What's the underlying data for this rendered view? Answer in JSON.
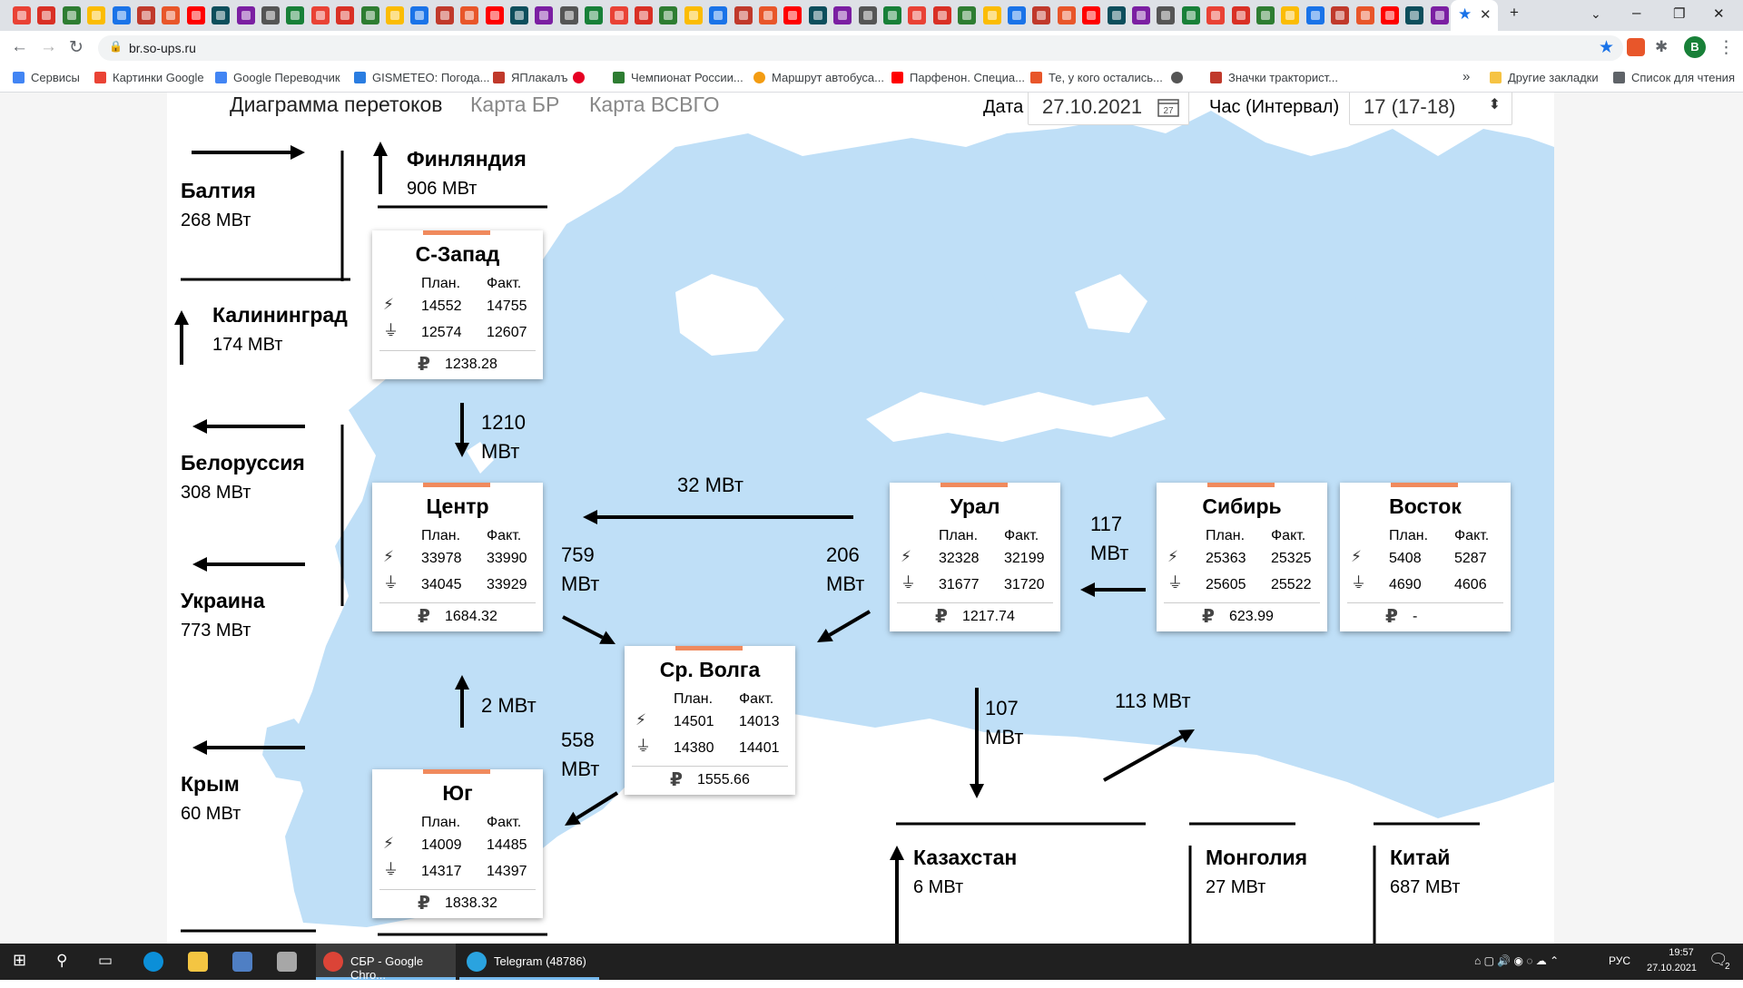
{
  "browser": {
    "url": "br.so-ups.ru",
    "profile_initial": "В",
    "bookmarks": [
      "Сервисы",
      "Картинки Google",
      "Google Переводчик",
      "GISMETEO: Погода...",
      "ЯПлакалъ",
      "Чемпионат России...",
      "Маршрут автобуса...",
      "Парфенон. Специа...",
      "Те, у кого остались...",
      "Значки тракторист..."
    ],
    "bookmarks_right": [
      "Другие закладки",
      "Список для чтения"
    ],
    "bookmarks_more": "»"
  },
  "header": {
    "tabs": [
      "Диаграмма перетоков",
      "Карта БР",
      "Карта ВСВГО"
    ],
    "date_label": "Дата",
    "date_value": "27.10.2021",
    "calendar_day": "27",
    "hour_label": "Час (Интервал)",
    "hour_value": "17 (17-18)"
  },
  "countries": [
    {
      "name": "Балтия",
      "value": "268 МВт"
    },
    {
      "name": "Финляндия",
      "value": "906 МВт"
    },
    {
      "name": "Калининград",
      "value": "174 МВт"
    },
    {
      "name": "Белоруссия",
      "value": "308 МВт"
    },
    {
      "name": "Украина",
      "value": "773 МВт"
    },
    {
      "name": "Крым",
      "value": "60 МВт"
    },
    {
      "name": "Казахстан",
      "value": "6 МВт"
    },
    {
      "name": "Монголия",
      "value": "27 МВт"
    },
    {
      "name": "Китай",
      "value": "687 МВт"
    }
  ],
  "table_headers": {
    "plan": "План.",
    "fact": "Факт.",
    "ruble": "₽"
  },
  "icons": {
    "generation": "lightning-icon",
    "consumption": "plug-icon"
  },
  "colors": {
    "accent": "#f08a5d",
    "map_land": "#bfdff7",
    "map_bg": "#ffffff"
  },
  "systems": [
    {
      "name": "С-Запад",
      "gen_plan": "14552",
      "gen_fact": "14755",
      "cons_plan": "12574",
      "cons_fact": "12607",
      "price": "1238.28"
    },
    {
      "name": "Центр",
      "gen_plan": "33978",
      "gen_fact": "33990",
      "cons_plan": "34045",
      "cons_fact": "33929",
      "price": "1684.32"
    },
    {
      "name": "Ср. Волга",
      "gen_plan": "14501",
      "gen_fact": "14013",
      "cons_plan": "14380",
      "cons_fact": "14401",
      "price": "1555.66"
    },
    {
      "name": "Юг",
      "gen_plan": "14009",
      "gen_fact": "14485",
      "cons_plan": "14317",
      "cons_fact": "14397",
      "price": "1838.32"
    },
    {
      "name": "Урал",
      "gen_plan": "32328",
      "gen_fact": "32199",
      "cons_plan": "31677",
      "cons_fact": "31720",
      "price": "1217.74"
    },
    {
      "name": "Сибирь",
      "gen_plan": "25363",
      "gen_fact": "25325",
      "cons_plan": "25605",
      "cons_fact": "25522",
      "price": "623.99"
    },
    {
      "name": "Восток",
      "gen_plan": "5408",
      "gen_fact": "5287",
      "cons_plan": "4690",
      "cons_fact": "4606",
      "price": "-"
    }
  ],
  "flows": [
    {
      "id": "nw-center",
      "value": "1210 МВт"
    },
    {
      "id": "ural-center",
      "value": "32 МВт"
    },
    {
      "id": "center-volga",
      "value": "759 МВт"
    },
    {
      "id": "ural-volga",
      "value": "206 МВт"
    },
    {
      "id": "siberia-ural",
      "value": "117 МВт"
    },
    {
      "id": "south-center",
      "value": "2 МВт"
    },
    {
      "id": "volga-south",
      "value": "558 МВт"
    },
    {
      "id": "ural-kazakhstan",
      "value": "107 МВт"
    },
    {
      "id": "kazakhstan-siberia",
      "value": "113 МВт"
    }
  ],
  "taskbar": {
    "items": [
      "СБР - Google Chro...",
      "Telegram (48786)"
    ],
    "language": "РУС",
    "time": "19:57",
    "date": "27.10.2021",
    "notifications": "2"
  }
}
